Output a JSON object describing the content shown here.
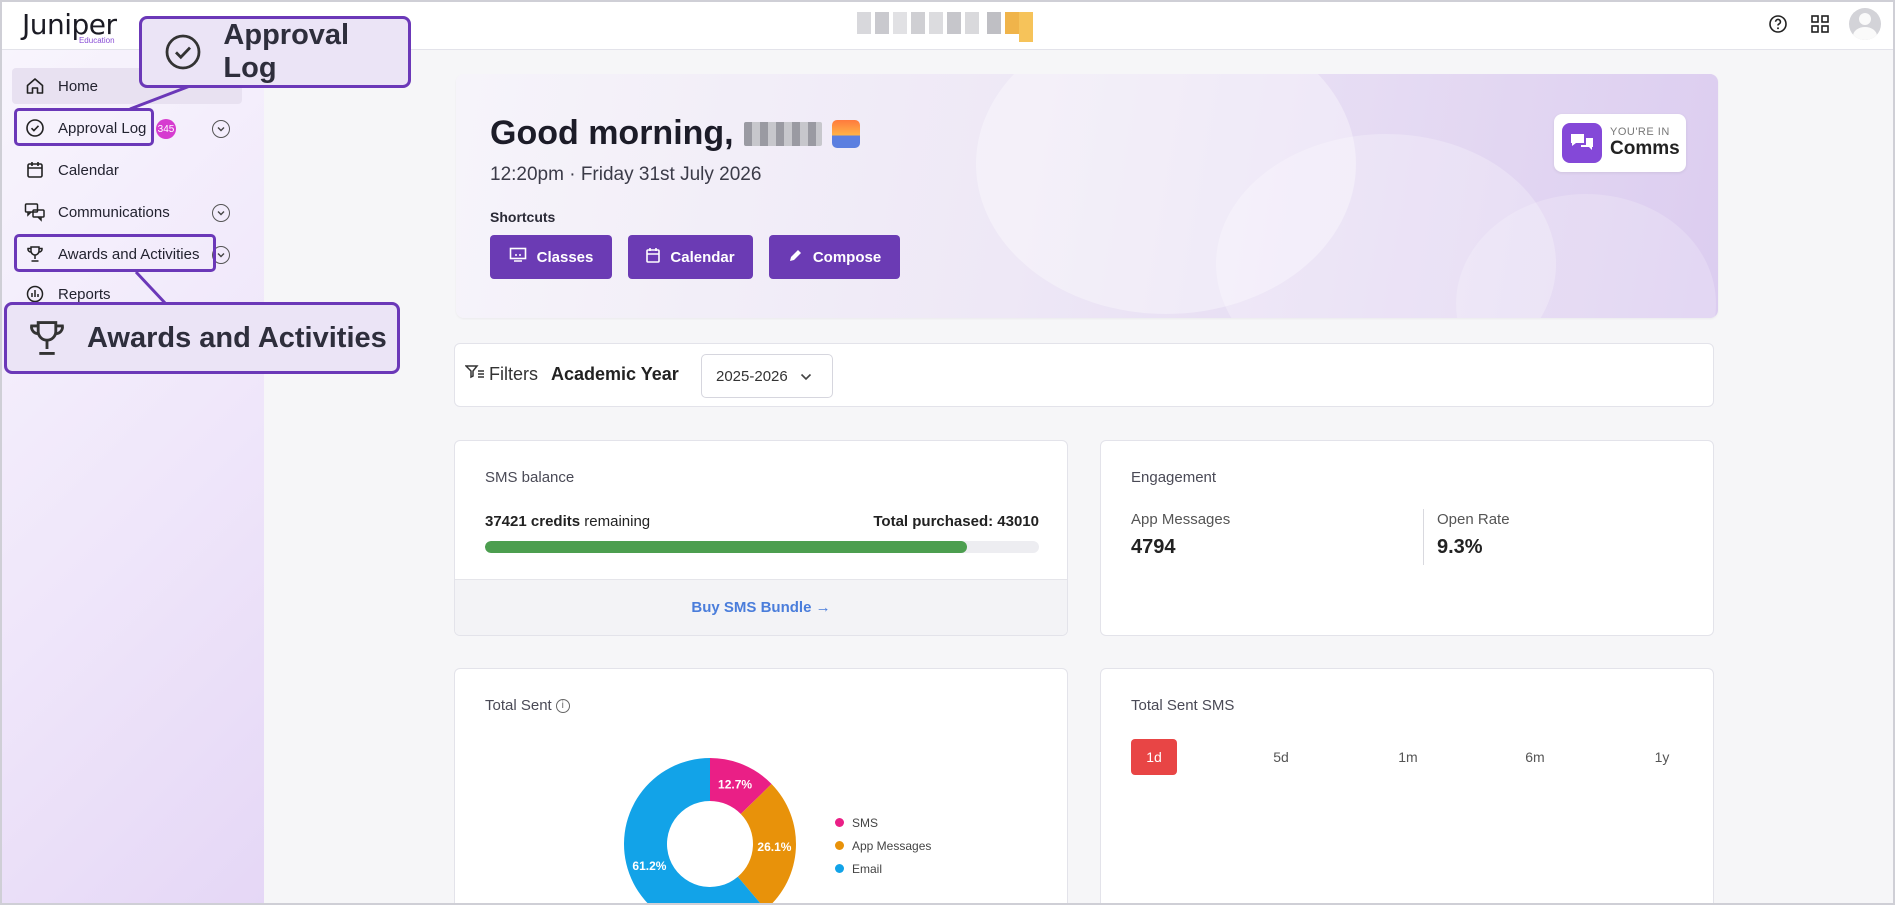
{
  "app": {
    "logo": "Juniper",
    "logo_sub": "Education"
  },
  "sidebar": {
    "items": [
      {
        "label": "Home"
      },
      {
        "label": "Approval Log",
        "badge": "345"
      },
      {
        "label": "Calendar"
      },
      {
        "label": "Communications"
      },
      {
        "label": "Awards and Activities"
      },
      {
        "label": "Reports"
      }
    ]
  },
  "callouts": {
    "approval": "Approval Log",
    "awards": "Awards and Activities"
  },
  "hero": {
    "greeting": "Good morning,",
    "time": "12:20pm · Friday 31st July 2026",
    "shortcuts_label": "Shortcuts",
    "shortcuts": [
      "Classes",
      "Calendar",
      "Compose"
    ],
    "inbox_small": "YOU'RE IN",
    "inbox_big": "Comms"
  },
  "filters": {
    "label": "Filters",
    "academic_year_label": "Academic Year",
    "academic_year_value": "2025-2026"
  },
  "sms_balance": {
    "title": "SMS balance",
    "credits": "37421",
    "credits_word": "credits",
    "remaining": "remaining",
    "total_label": "Total purchased: 43010",
    "total_purchased": 43010,
    "remaining_fraction": 0.87,
    "buy_label": "Buy SMS Bundle →"
  },
  "engagement": {
    "title": "Engagement",
    "app_messages_label": "App Messages",
    "app_messages_value": "4794",
    "open_rate_label": "Open Rate",
    "open_rate_value": "9.3%"
  },
  "total_sent": {
    "title": "Total Sent"
  },
  "total_sent_sms": {
    "title": "Total Sent SMS",
    "ranges": [
      "1d",
      "5d",
      "1m",
      "6m",
      "1y"
    ],
    "active": "1d"
  },
  "colors": {
    "accent": "#6b3bb4",
    "sms": "#ea1f86",
    "app_messages": "#e8920a",
    "email": "#12a3e8",
    "progress": "#4c9e4f",
    "range_active": "#e84545"
  },
  "chart_data": {
    "type": "pie",
    "series": [
      {
        "name": "SMS",
        "value": 12.7,
        "label": "12.7%"
      },
      {
        "name": "App Messages",
        "value": 26.1,
        "label": "26.1%"
      },
      {
        "name": "Email",
        "value": 61.2,
        "label": "61.2%"
      }
    ],
    "title": "Total Sent",
    "legend": "right"
  }
}
